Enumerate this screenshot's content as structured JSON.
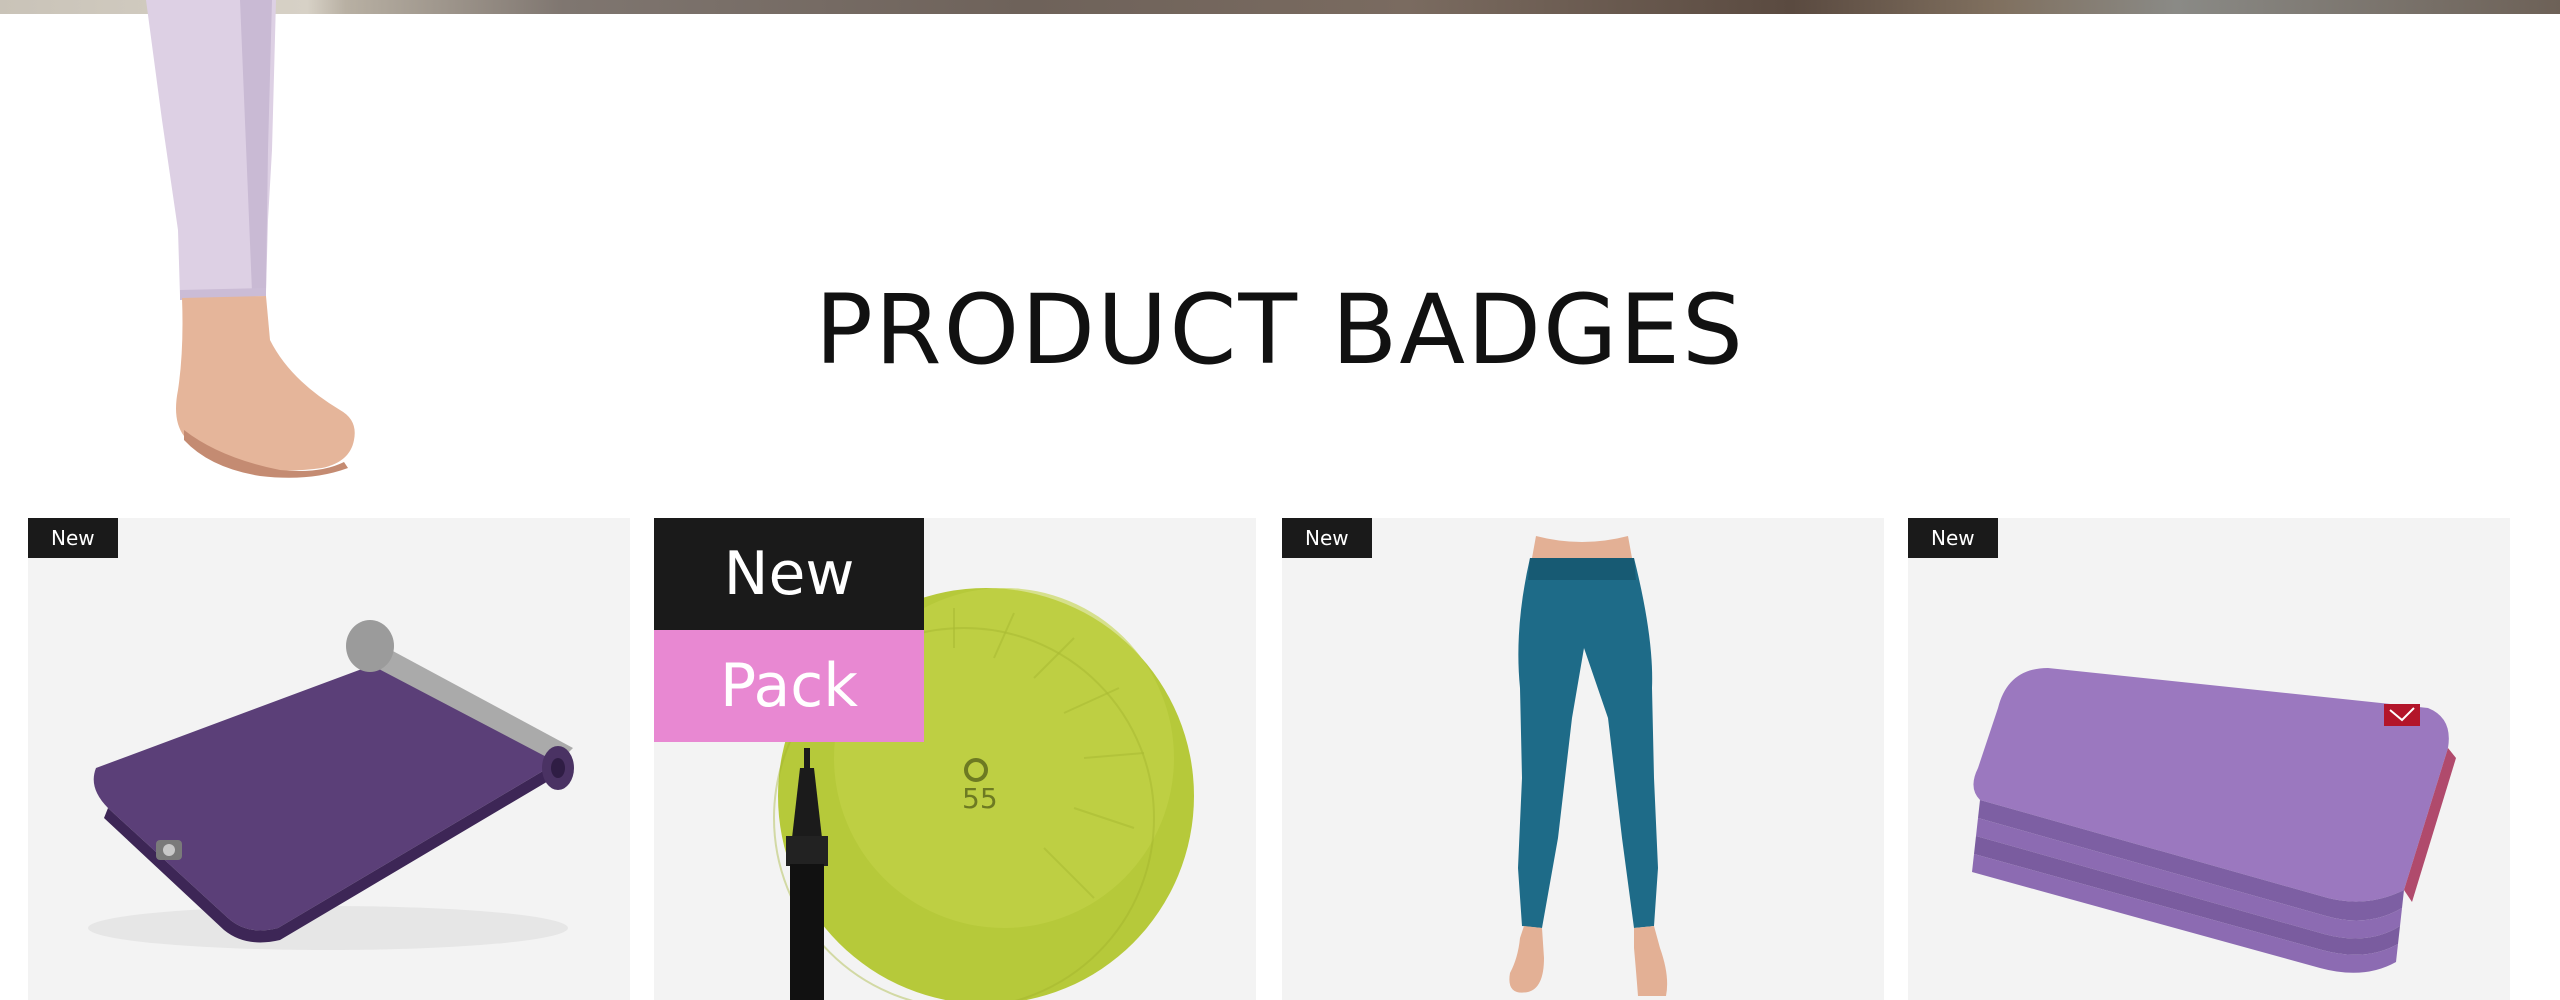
{
  "section": {
    "title": "PRODUCT BADGES"
  },
  "products": [
    {
      "name": "yoga-mat",
      "badges": [
        "New"
      ]
    },
    {
      "name": "exercise-ball",
      "badges": [
        "New",
        "Pack"
      ],
      "ball_label": "55"
    },
    {
      "name": "leggings",
      "badges": [
        "New"
      ]
    },
    {
      "name": "yoga-towel",
      "badges": [
        "New"
      ]
    }
  ],
  "colors": {
    "badge_dark": "#1a1a1a",
    "badge_pink": "#e888d2",
    "card_bg": "#f3f3f3"
  }
}
